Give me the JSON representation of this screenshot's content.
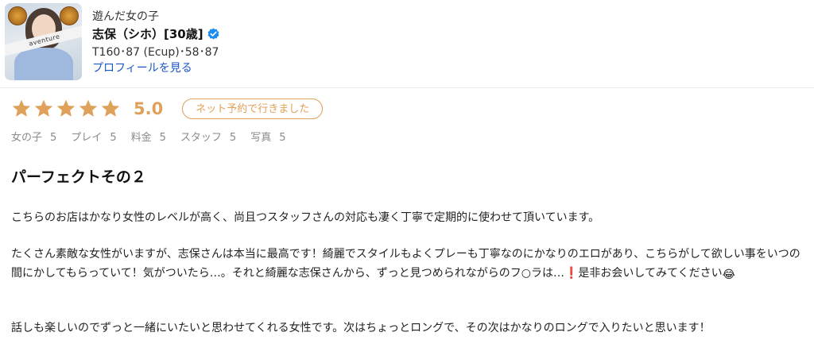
{
  "header": {
    "label": "遊んだ女の子",
    "name": "志保（シホ）[30歳]",
    "stats": "T160･87 (Ecup)･58･87",
    "profile_link": "プロフィールを見る",
    "avatar_band_text": "aventure"
  },
  "rating": {
    "stars": 5,
    "score": "5.0",
    "tag": "ネット予約で行きました",
    "star_color": "#e0a15a"
  },
  "subscores": [
    {
      "label": "女の子",
      "value": "5"
    },
    {
      "label": "プレイ",
      "value": "5"
    },
    {
      "label": "料金",
      "value": "5"
    },
    {
      "label": "スタッフ",
      "value": "5"
    },
    {
      "label": "写真",
      "value": "5"
    }
  ],
  "review": {
    "title": "パーフェクトその２",
    "p1": "こちらのお店はかなり女性のレベルが高く、尚且つスタッフさんの対応も凄く丁寧で定期的に使わせて頂いています。",
    "p2_a": "たくさん素敵な女性がいますが、志保さんは本当に最高です！綺麗でスタイルもよくプレーも丁寧なのにかなりのエロがあり、こちらがして欲しい事をいつの間にかしてもらっていて！気がついたら…。それと綺麗な志保さんから、ずっと見つめられながらのフ○ラは…",
    "p2_exclaim": "❗",
    "p2_b": "是非お会いしてみてください",
    "p2_emoji": "😂",
    "p3": "話しも楽しいのでずっと一緒にいたいと思わせてくれる女性です。次はちょっとロングで、その次はかなりのロングで入りたいと思います！"
  }
}
